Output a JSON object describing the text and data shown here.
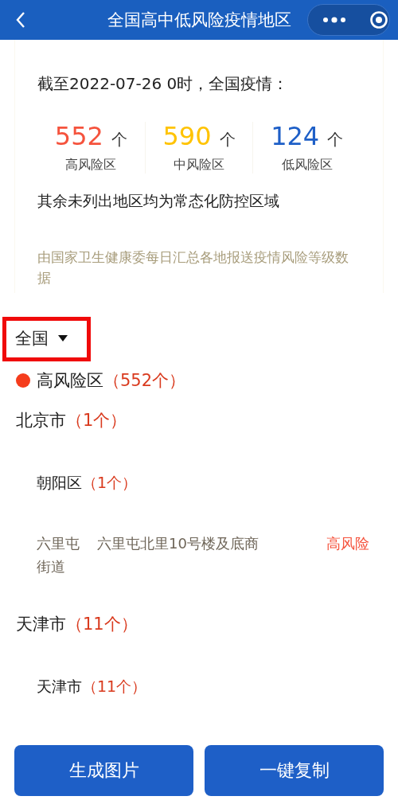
{
  "header": {
    "title": "全国高中低风险疫情地区"
  },
  "summary": {
    "heading": "截至2022-07-26 0时，全国疫情：",
    "stats": [
      {
        "count": "552",
        "unit": "个",
        "label": "高风险区",
        "color": "#f5533d"
      },
      {
        "count": "590",
        "unit": "个",
        "label": "中风险区",
        "color": "#ffc300"
      },
      {
        "count": "124",
        "unit": "个",
        "label": "低风险区",
        "color": "#1e5fc7"
      }
    ],
    "note": "其余未列出地区均为常态化防控区域",
    "source": "由国家卫生健康委每日汇总各地报送疫情风险等级数据"
  },
  "region_selector": {
    "label": "全国",
    "highlighted": true
  },
  "risk_legend": {
    "label": "高风险区",
    "count": "（552个）",
    "color": "#f53c1c"
  },
  "provinces": [
    {
      "name": "北京市",
      "count": "（1个）",
      "districts": [
        {
          "name": "朝阳区",
          "count": "（1个）",
          "areas": [
            {
              "street": "六里屯街道",
              "address": "六里屯北里10号楼及底商",
              "level": "高风险"
            }
          ]
        }
      ]
    },
    {
      "name": "天津市",
      "count": "（11个）",
      "districts": [
        {
          "name": "天津市",
          "count": "（11个）"
        }
      ]
    }
  ],
  "buttons": [
    "生成图片",
    "一键复制"
  ]
}
